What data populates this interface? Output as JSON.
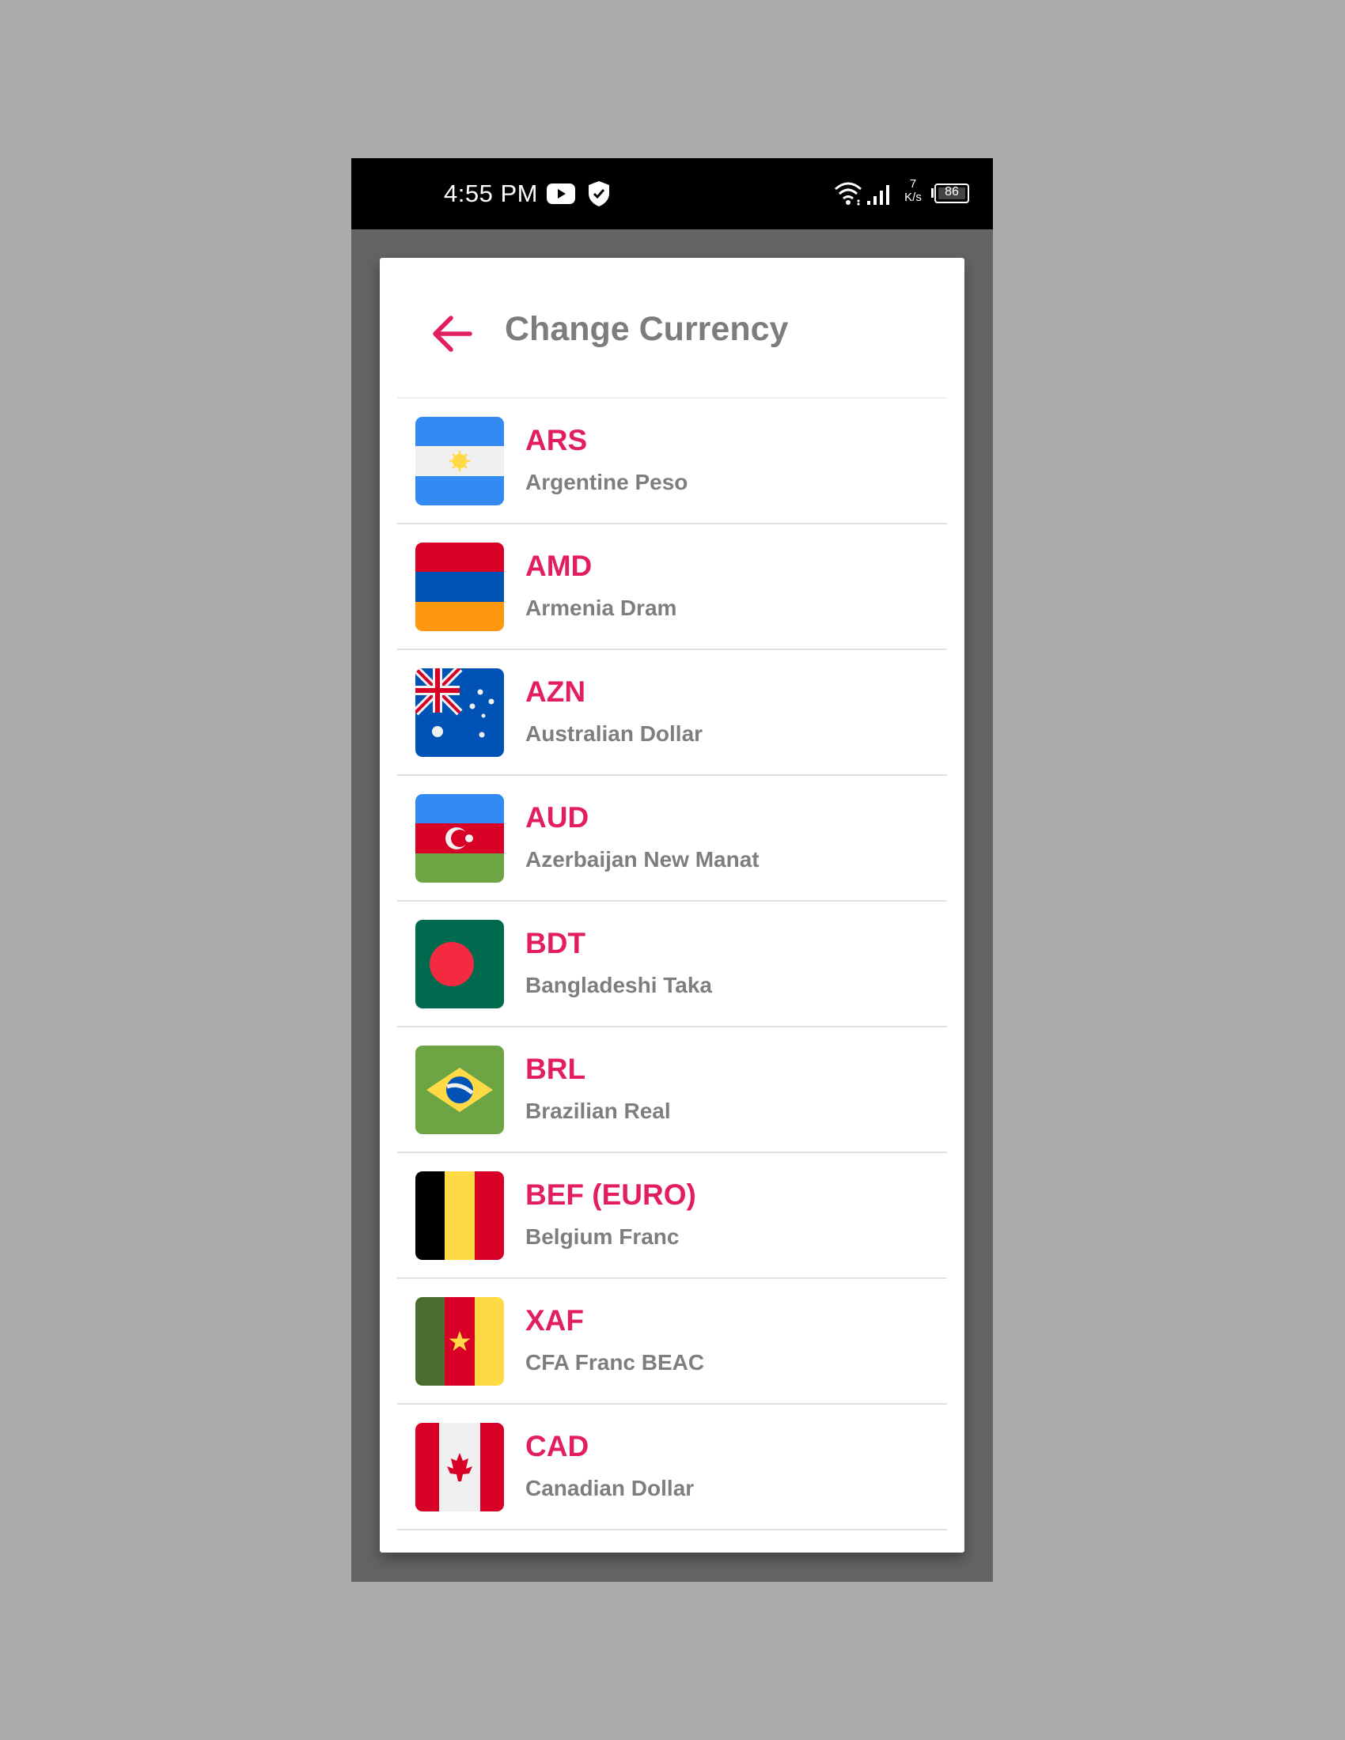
{
  "status_bar": {
    "time": "4:55 PM",
    "net_speed_value": "7",
    "net_speed_unit": "K/s",
    "battery": "86",
    "icons": [
      "youtube-icon",
      "shield-check-icon",
      "wifi-icon",
      "signal-icon",
      "battery-icon"
    ]
  },
  "header": {
    "title": "Change Currency",
    "back_icon": "arrow-left-icon"
  },
  "colors": {
    "accent": "#e31e5f",
    "text_secondary": "#7e7e7e",
    "title": "#7d7d7d"
  },
  "currencies": [
    {
      "code": "ARS",
      "name": "Argentine Peso",
      "flag": "argentina-flag-icon"
    },
    {
      "code": "AMD",
      "name": "Armenia Dram",
      "flag": "armenia-flag-icon"
    },
    {
      "code": "AZN",
      "name": "Australian Dollar",
      "flag": "australia-flag-icon"
    },
    {
      "code": "AUD",
      "name": "Azerbaijan New Manat",
      "flag": "azerbaijan-flag-icon"
    },
    {
      "code": "BDT",
      "name": "Bangladeshi Taka",
      "flag": "bangladesh-flag-icon"
    },
    {
      "code": "BRL",
      "name": "Brazilian Real",
      "flag": "brazil-flag-icon"
    },
    {
      "code": "BEF (EURO)",
      "name": "Belgium Franc",
      "flag": "belgium-flag-icon"
    },
    {
      "code": "XAF",
      "name": "CFA Franc BEAC",
      "flag": "cameroon-flag-icon"
    },
    {
      "code": "CAD",
      "name": "Canadian Dollar",
      "flag": "canada-flag-icon"
    }
  ]
}
